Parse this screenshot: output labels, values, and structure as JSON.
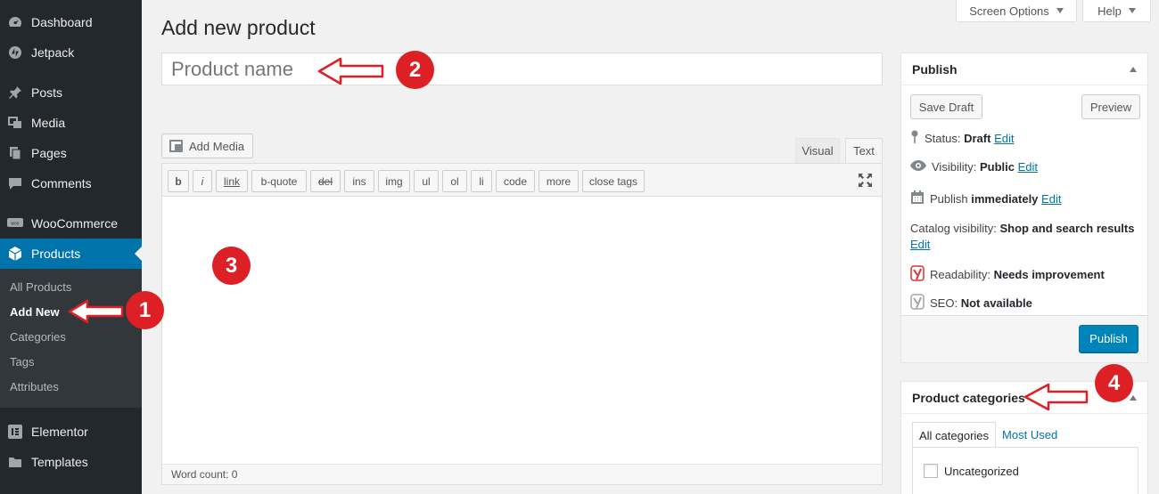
{
  "sidebar": {
    "items": [
      {
        "label": "Dashboard",
        "icon": "dashboard-icon"
      },
      {
        "label": "Jetpack",
        "icon": "jetpack-icon"
      },
      {
        "label": "Posts",
        "icon": "pushpin-icon"
      },
      {
        "label": "Media",
        "icon": "media-icon"
      },
      {
        "label": "Pages",
        "icon": "pages-icon"
      },
      {
        "label": "Comments",
        "icon": "comments-icon"
      },
      {
        "label": "WooCommerce",
        "icon": "woocommerce-icon"
      },
      {
        "label": "Products",
        "icon": "products-icon"
      },
      {
        "label": "Elementor",
        "icon": "elementor-icon"
      },
      {
        "label": "Templates",
        "icon": "folder-icon"
      }
    ],
    "submenu": [
      "All Products",
      "Add New",
      "Categories",
      "Tags",
      "Attributes"
    ]
  },
  "top": {
    "screen_options": "Screen Options",
    "help": "Help"
  },
  "page": {
    "title": "Add new product",
    "title_placeholder": "Product name"
  },
  "editor": {
    "add_media": "Add Media",
    "tab_visual": "Visual",
    "tab_text": "Text",
    "quicktags": [
      "b",
      "i",
      "link",
      "b-quote",
      "del",
      "ins",
      "img",
      "ul",
      "ol",
      "li",
      "code",
      "more",
      "close tags"
    ],
    "word_count": "Word count: 0"
  },
  "publish_box": {
    "title": "Publish",
    "save_draft": "Save Draft",
    "preview": "Preview",
    "status_label": "Status:",
    "status_value": "Draft",
    "visibility_label": "Visibility:",
    "visibility_value": "Public",
    "publish_label": "Publish",
    "publish_value": "immediately",
    "catalog_label": "Catalog visibility:",
    "catalog_value": "Shop and search results",
    "readability_label": "Readability:",
    "readability_value": "Needs improvement",
    "seo_label": "SEO:",
    "seo_value": "Not available",
    "edit": "Edit",
    "publish_button": "Publish"
  },
  "categories_box": {
    "title": "Product categories",
    "tab_all": "All categories",
    "tab_most_used": "Most Used",
    "items": [
      "Uncategorized"
    ]
  },
  "annotations": [
    "1",
    "2",
    "3",
    "4"
  ],
  "colors": {
    "sidebar_bg": "#23282d",
    "active_menu": "#0073aa",
    "publish_button": "#0085ba",
    "annotation_red": "#dd1f26"
  }
}
